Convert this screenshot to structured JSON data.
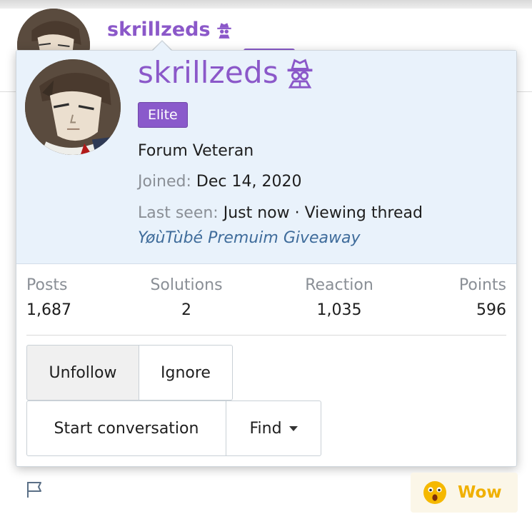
{
  "background": {
    "username": "skrillzeds"
  },
  "popup": {
    "username": "skrillzeds",
    "badge": "Elite",
    "user_title": "Forum Veteran",
    "joined_label": "Joined:",
    "joined_value": "Dec 14, 2020",
    "last_seen_label": "Last seen:",
    "last_seen_value": "Just now · Viewing thread",
    "thread_link": "YøùTùbé Premuim Giveaway",
    "stats": [
      {
        "label": "Posts",
        "value": "1,687"
      },
      {
        "label": "Solutions",
        "value": "2"
      },
      {
        "label": "Reaction",
        "value": "1,035"
      },
      {
        "label": "Points",
        "value": "596"
      }
    ],
    "buttons": {
      "unfollow": "Unfollow",
      "ignore": "Ignore",
      "start_conversation": "Start conversation",
      "find": "Find"
    }
  },
  "footer": {
    "reaction_label": "Wow"
  },
  "colors": {
    "username": "#8b58c9",
    "badge": "#8a5acb",
    "header_bg": "#e9f2fb",
    "link": "#3f6c9b",
    "wow": "#f0b000"
  },
  "icons": {
    "spy": "spy-icon",
    "flag": "flag-icon",
    "wow": "wow-emoji-icon",
    "caret": "chevron-down-icon"
  }
}
